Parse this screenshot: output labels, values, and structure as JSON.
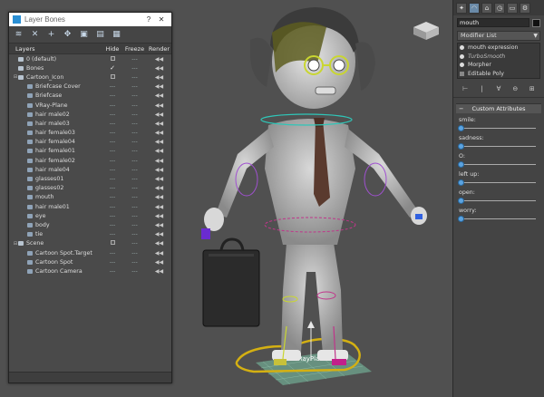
{
  "dialog": {
    "title": "Layer Bones",
    "help_glyph": "?",
    "close_glyph": "✕",
    "toolbar_icons": [
      "layers-icon",
      "delete-icon",
      "add-icon",
      "select-icon",
      "highlight-icon",
      "hide-all-icon",
      "freeze-all-icon"
    ],
    "columns": {
      "layers": "Layers",
      "hide": "Hide",
      "freeze": "Freeze",
      "render": "Render"
    },
    "rows": [
      {
        "name": "0 (default)",
        "level": 0,
        "type": "layer",
        "expander": "",
        "hide": "box",
        "freeze": "---",
        "render": "◀◀"
      },
      {
        "name": "Bones",
        "level": 0,
        "type": "layer",
        "expander": "",
        "hide": "check",
        "freeze": "---",
        "render": "◀◀"
      },
      {
        "name": "Cartoon_Icon",
        "level": 0,
        "type": "layer",
        "expander": "⊟",
        "hide": "box",
        "freeze": "---",
        "render": "◀◀"
      },
      {
        "name": "Briefcase Cover",
        "level": 1,
        "type": "obj",
        "expander": "",
        "hide": "---",
        "freeze": "---",
        "render": "◀◀"
      },
      {
        "name": "Briefcase",
        "level": 1,
        "type": "obj",
        "expander": "",
        "hide": "---",
        "freeze": "---",
        "render": "◀◀"
      },
      {
        "name": "VRay-Plane",
        "level": 1,
        "type": "obj",
        "expander": "",
        "hide": "---",
        "freeze": "---",
        "render": "◀◀"
      },
      {
        "name": "hair male02",
        "level": 1,
        "type": "obj",
        "expander": "",
        "hide": "---",
        "freeze": "---",
        "render": "◀◀"
      },
      {
        "name": "hair male03",
        "level": 1,
        "type": "obj",
        "expander": "",
        "hide": "---",
        "freeze": "---",
        "render": "◀◀"
      },
      {
        "name": "hair female03",
        "level": 1,
        "type": "obj",
        "expander": "",
        "hide": "---",
        "freeze": "---",
        "render": "◀◀"
      },
      {
        "name": "hair female04",
        "level": 1,
        "type": "obj",
        "expander": "",
        "hide": "---",
        "freeze": "---",
        "render": "◀◀"
      },
      {
        "name": "hair female01",
        "level": 1,
        "type": "obj",
        "expander": "",
        "hide": "---",
        "freeze": "---",
        "render": "◀◀"
      },
      {
        "name": "hair female02",
        "level": 1,
        "type": "obj",
        "expander": "",
        "hide": "---",
        "freeze": "---",
        "render": "◀◀"
      },
      {
        "name": "hair male04",
        "level": 1,
        "type": "obj",
        "expander": "",
        "hide": "---",
        "freeze": "---",
        "render": "◀◀"
      },
      {
        "name": "glasses01",
        "level": 1,
        "type": "obj",
        "expander": "",
        "hide": "---",
        "freeze": "---",
        "render": "◀◀"
      },
      {
        "name": "glasses02",
        "level": 1,
        "type": "obj",
        "expander": "",
        "hide": "---",
        "freeze": "---",
        "render": "◀◀"
      },
      {
        "name": "mouth",
        "level": 1,
        "type": "obj",
        "expander": "",
        "hide": "---",
        "freeze": "---",
        "render": "◀◀"
      },
      {
        "name": "hair male01",
        "level": 1,
        "type": "obj",
        "expander": "",
        "hide": "---",
        "freeze": "---",
        "render": "◀◀"
      },
      {
        "name": "eye",
        "level": 1,
        "type": "obj",
        "expander": "",
        "hide": "---",
        "freeze": "---",
        "render": "◀◀"
      },
      {
        "name": "body",
        "level": 1,
        "type": "obj",
        "expander": "",
        "hide": "---",
        "freeze": "---",
        "render": "◀◀"
      },
      {
        "name": "tie",
        "level": 1,
        "type": "obj",
        "expander": "",
        "hide": "---",
        "freeze": "---",
        "render": "◀◀"
      },
      {
        "name": "Scene",
        "level": 0,
        "type": "layer",
        "expander": "⊟",
        "hide": "box",
        "freeze": "---",
        "render": "◀◀"
      },
      {
        "name": "Cartoon Spot.Target",
        "level": 1,
        "type": "obj",
        "expander": "",
        "hide": "---",
        "freeze": "---",
        "render": "◀◀"
      },
      {
        "name": "Cartoon Spot",
        "level": 1,
        "type": "obj",
        "expander": "",
        "hide": "---",
        "freeze": "---",
        "render": "◀◀"
      },
      {
        "name": "Cartoon Camera",
        "level": 1,
        "type": "obj",
        "expander": "",
        "hide": "---",
        "freeze": "---",
        "render": "◀◀"
      }
    ]
  },
  "viewport": {
    "plane_label": "VRayPlane"
  },
  "command_panel": {
    "tab_glyphs": [
      "✦",
      "◠",
      "⌂",
      "◷",
      "▭",
      "⚙"
    ],
    "object_name": "mouth",
    "modifier_list": "Modifier List",
    "stack": [
      {
        "label": "mouth expression",
        "style": "normal",
        "marker": "bulb"
      },
      {
        "label": "TurboSmooth",
        "style": "italic",
        "marker": "bulb"
      },
      {
        "label": "Morpher",
        "style": "normal",
        "marker": "bulb"
      },
      {
        "label": "Editable Poly",
        "style": "normal",
        "marker": "square"
      }
    ],
    "stack_tool_glyphs": [
      "⊢",
      "|",
      "∀",
      "⊖",
      "⊞"
    ],
    "rollout": {
      "minus": "−",
      "title": "Custom Attributes",
      "sliders": [
        {
          "label": "smile:",
          "value": 0
        },
        {
          "label": "sadness:",
          "value": 0
        },
        {
          "label": "O:",
          "value": 0
        },
        {
          "label": "left up:",
          "value": 0
        },
        {
          "label": "open:",
          "value": 0
        },
        {
          "label": "worry:",
          "value": 0
        }
      ]
    }
  }
}
